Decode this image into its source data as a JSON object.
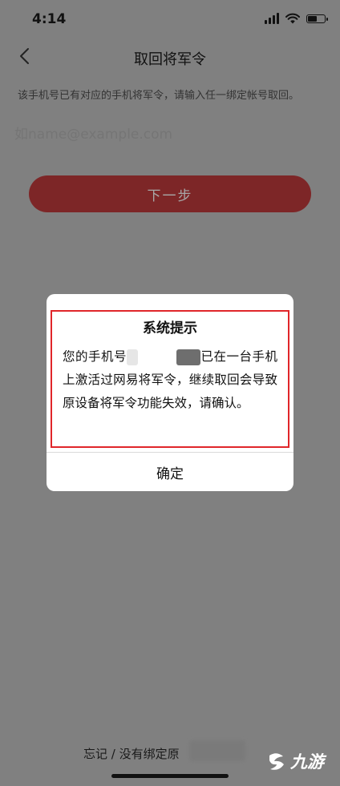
{
  "status": {
    "time": "4:14"
  },
  "nav": {
    "title": "取回将军令"
  },
  "hint": "该手机号已有对应的手机将军令，请输入任一绑定帐号取回。",
  "form": {
    "email_placeholder": "如name@example.com",
    "next_label": "下一步"
  },
  "dialog": {
    "title": "系统提示",
    "body_prefix": "您的手机号",
    "body_suffix": "已在一台手机上激活过网易将军令，继续取回会导致原设备将军令功能失效，请确认。",
    "confirm_label": "确定"
  },
  "footer": {
    "forgot_text": "忘记 / 没有绑定原"
  },
  "watermark": {
    "text": "九游"
  },
  "colors": {
    "overlay": "#808080",
    "button": "#7d2627",
    "highlight": "#e0262a"
  }
}
